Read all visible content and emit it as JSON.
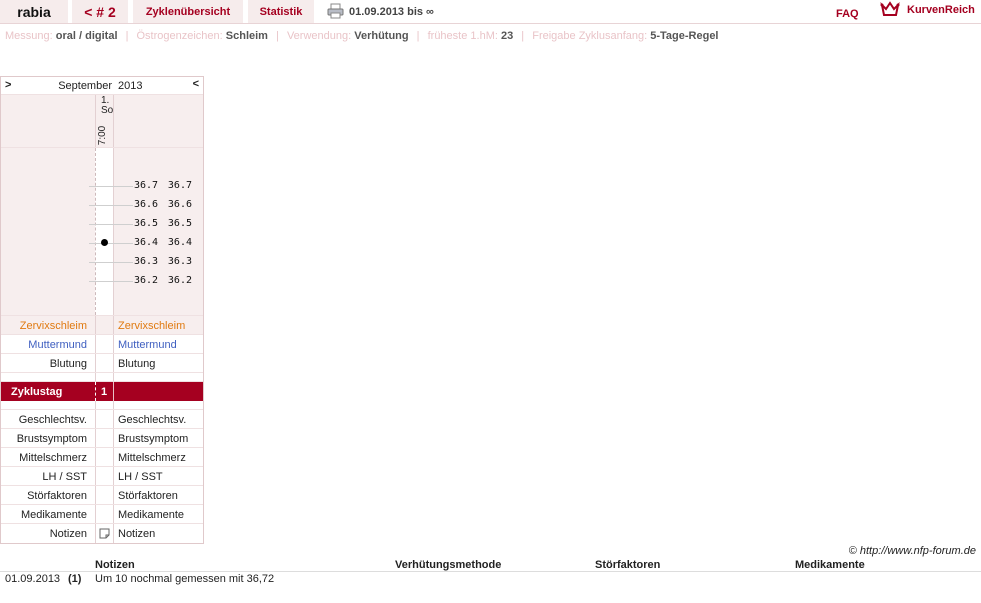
{
  "header": {
    "user": "rabia",
    "back_label": "< # 2",
    "overview_label": "Zyklenübersicht",
    "stats_label": "Statistik",
    "date_range": "01.09.2013 bis ∞",
    "faq_label": "FAQ",
    "brand": "KurvenReich"
  },
  "settings": {
    "measure_label": "Messung:",
    "measure_value": "oral / digital",
    "estrogen_label": "Östrogenzeichen:",
    "estrogen_value": "Schleim",
    "use_label": "Verwendung:",
    "use_value": "Verhütung",
    "earliest_label": "früheste 1.hM:",
    "earliest_value": "23",
    "release_label": "Freigabe Zyklusanfang:",
    "release_value": "5-Tage-Regel"
  },
  "chart": {
    "nav_prev": ">",
    "nav_next": "<",
    "month": "September",
    "year": "2013",
    "day_number": "1.",
    "day_name": "So",
    "time": "7:00",
    "temps": [
      "36.7",
      "36.6",
      "36.5",
      "36.4",
      "36.3",
      "36.2"
    ],
    "measured_temp": "36.4",
    "rows": {
      "zervix": "Zervixschleim",
      "muttermund": "Muttermund",
      "blutung": "Blutung",
      "zyklustag": "Zyklustag",
      "zyklustag_value": "1",
      "geschlecht": "Geschlechtsv.",
      "brust": "Brustsymptom",
      "mittel": "Mittelschmerz",
      "lh": "LH / SST",
      "stoer": "Störfaktoren",
      "medi": "Medikamente",
      "notizen": "Notizen"
    }
  },
  "footer": {
    "copyright": "© http://www.nfp-forum.de"
  },
  "notes_table": {
    "headers": [
      "Notizen",
      "Verhütungsmethode",
      "Störfaktoren",
      "Medikamente"
    ],
    "row": {
      "date": "01.09.2013",
      "day": "(1)",
      "note": "Um 10 nochmal gemessen mit 36,72"
    }
  },
  "colors": {
    "accent": "#a50020",
    "tab_bg": "#f6ecec",
    "muted": "#e9c4c8",
    "orange": "#e07a10",
    "blue": "#3f5fc0"
  }
}
